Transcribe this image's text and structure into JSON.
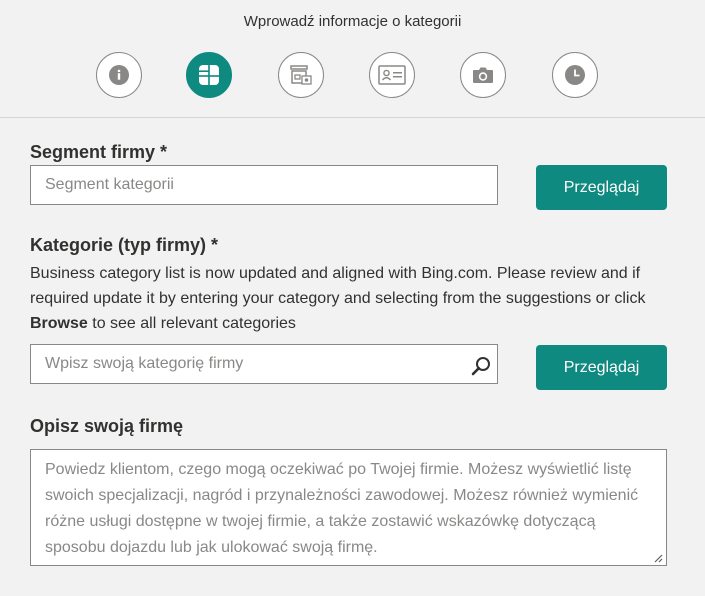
{
  "header": {
    "title": "Wprowadź informacje o kategorii",
    "steps": [
      {
        "icon": "info-icon",
        "active": false
      },
      {
        "icon": "category-icon",
        "active": true
      },
      {
        "icon": "store-icon",
        "active": false
      },
      {
        "icon": "contact-card-icon",
        "active": false
      },
      {
        "icon": "camera-icon",
        "active": false
      },
      {
        "icon": "clock-icon",
        "active": false
      }
    ]
  },
  "segment": {
    "label": "Segment firmy *",
    "placeholder": "Segment kategorii",
    "browse_label": "Przeglądaj"
  },
  "category": {
    "label": "Kategorie (typ firmy) *",
    "description_before": "Business category list is now updated and aligned with Bing.com. Please review and if required update it by entering your category and selecting from the suggestions or click ",
    "description_bold": "Browse",
    "description_after": " to see all relevant categories",
    "placeholder": "Wpisz swoją kategorię firmy",
    "browse_label": "Przeglądaj"
  },
  "description": {
    "label": "Opisz swoją firmę",
    "placeholder": "Powiedz klientom, czego mogą oczekiwać po Twojej firmie. Możesz wyświetlić listę swoich specjalizacji, nagród i przynależności zawodowej. Możesz również wymienić różne usługi dostępne w twojej firmie, a także zostawić wskazówkę dotyczącą sposobu dojazdu lub jak ulokować swoją firmę."
  },
  "colors": {
    "accent": "#0f8a80",
    "background": "#f2f2f2"
  }
}
